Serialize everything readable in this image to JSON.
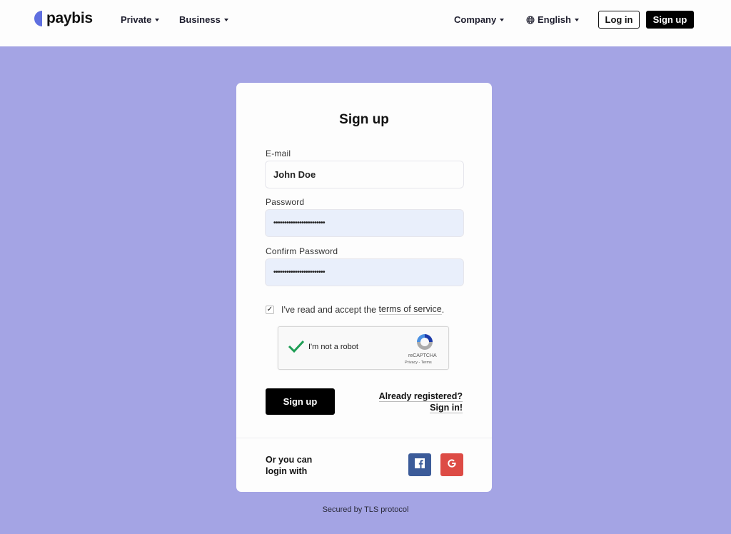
{
  "header": {
    "logo": "paybis",
    "nav_left": [
      {
        "label": "Private"
      },
      {
        "label": "Business"
      }
    ],
    "nav_right": [
      {
        "label": "Company"
      },
      {
        "label": "English",
        "icon": "globe-icon"
      }
    ],
    "login_label": "Log in",
    "signup_label": "Sign up"
  },
  "form": {
    "title": "Sign up",
    "email": {
      "label": "E-mail",
      "value": "John Doe"
    },
    "password": {
      "label": "Password",
      "value": "••••••••••••••••••••••••"
    },
    "confirm_password": {
      "label": "Confirm Password",
      "value": "••••••••••••••••••••••••"
    },
    "terms": {
      "checked": true,
      "prefix": "I've read and accept the ",
      "link": "terms of service",
      "suffix": "."
    },
    "captcha": {
      "label": "I'm not a robot",
      "brand": "reCAPTCHA",
      "links": "Privacy - Terms",
      "checked": true
    },
    "submit_label": "Sign up",
    "already_registered": "Already registered?",
    "sign_in_link": "Sign in!",
    "social_prompt": "Or you can login with",
    "social": [
      {
        "name": "facebook",
        "color": "#3b5b99"
      },
      {
        "name": "google",
        "color": "#dd4b45"
      }
    ]
  },
  "footer": {
    "text": "Secured by TLS protocol"
  }
}
